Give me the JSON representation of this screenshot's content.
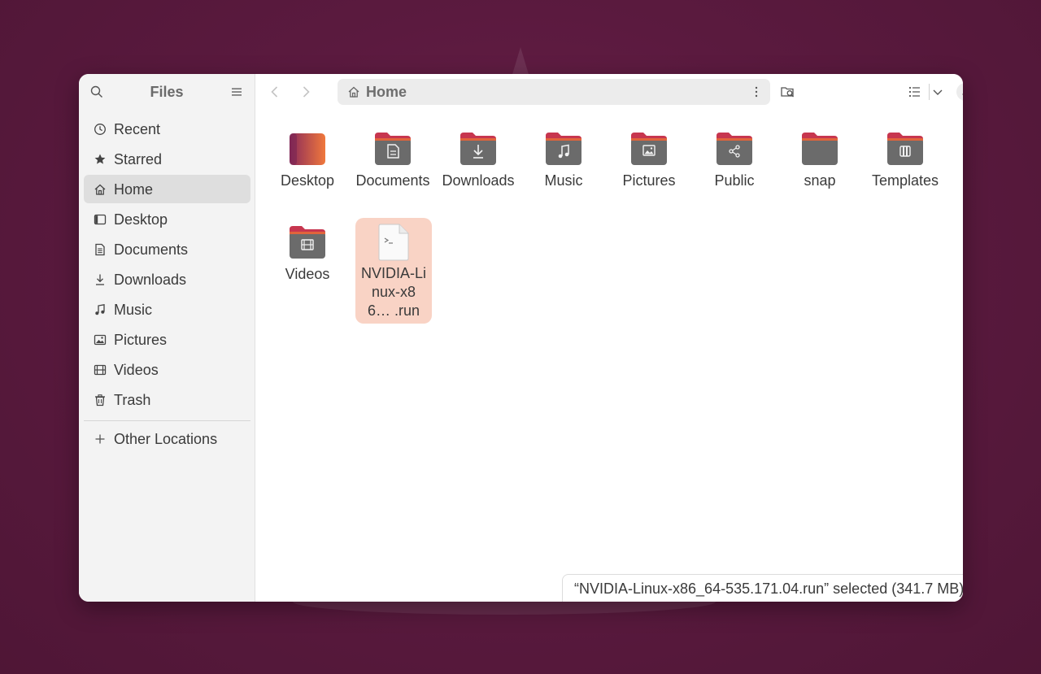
{
  "sidebar": {
    "title": "Files",
    "items": [
      {
        "label": "Recent",
        "icon": "clock-icon"
      },
      {
        "label": "Starred",
        "icon": "star-icon"
      },
      {
        "label": "Home",
        "icon": "home-icon"
      },
      {
        "label": "Desktop",
        "icon": "desktop-icon"
      },
      {
        "label": "Documents",
        "icon": "document-icon"
      },
      {
        "label": "Downloads",
        "icon": "download-icon"
      },
      {
        "label": "Music",
        "icon": "music-icon"
      },
      {
        "label": "Pictures",
        "icon": "picture-icon"
      },
      {
        "label": "Videos",
        "icon": "video-icon"
      },
      {
        "label": "Trash",
        "icon": "trash-icon"
      }
    ],
    "active_item": "Home",
    "other_locations": "Other Locations"
  },
  "header": {
    "path": "Home"
  },
  "files": [
    {
      "name": "Desktop",
      "icon": "desktop-folder-icon"
    },
    {
      "name": "Documents",
      "icon": "documents-folder-icon"
    },
    {
      "name": "Downloads",
      "icon": "downloads-folder-icon"
    },
    {
      "name": "Music",
      "icon": "music-folder-icon"
    },
    {
      "name": "Pictures",
      "icon": "pictures-folder-icon"
    },
    {
      "name": "Public",
      "icon": "public-folder-icon"
    },
    {
      "name": "snap",
      "icon": "folder-icon"
    },
    {
      "name": "Templates",
      "icon": "templates-folder-icon"
    },
    {
      "name": "Videos",
      "icon": "videos-folder-icon"
    },
    {
      "name": "NVIDIA-Linux-x86… .run",
      "icon": "script-file-icon",
      "selected": true
    }
  ],
  "status": {
    "text": "“NVIDIA-Linux-x86_64-535.171.04.run” selected  (341.7 MB)"
  },
  "colors": {
    "selection": "#f9d3c5",
    "folder_tab": "#c7364f",
    "folder_body": "#6b6b6b",
    "desktop_start": "#8a2a5a",
    "desktop_end": "#f0783c"
  }
}
